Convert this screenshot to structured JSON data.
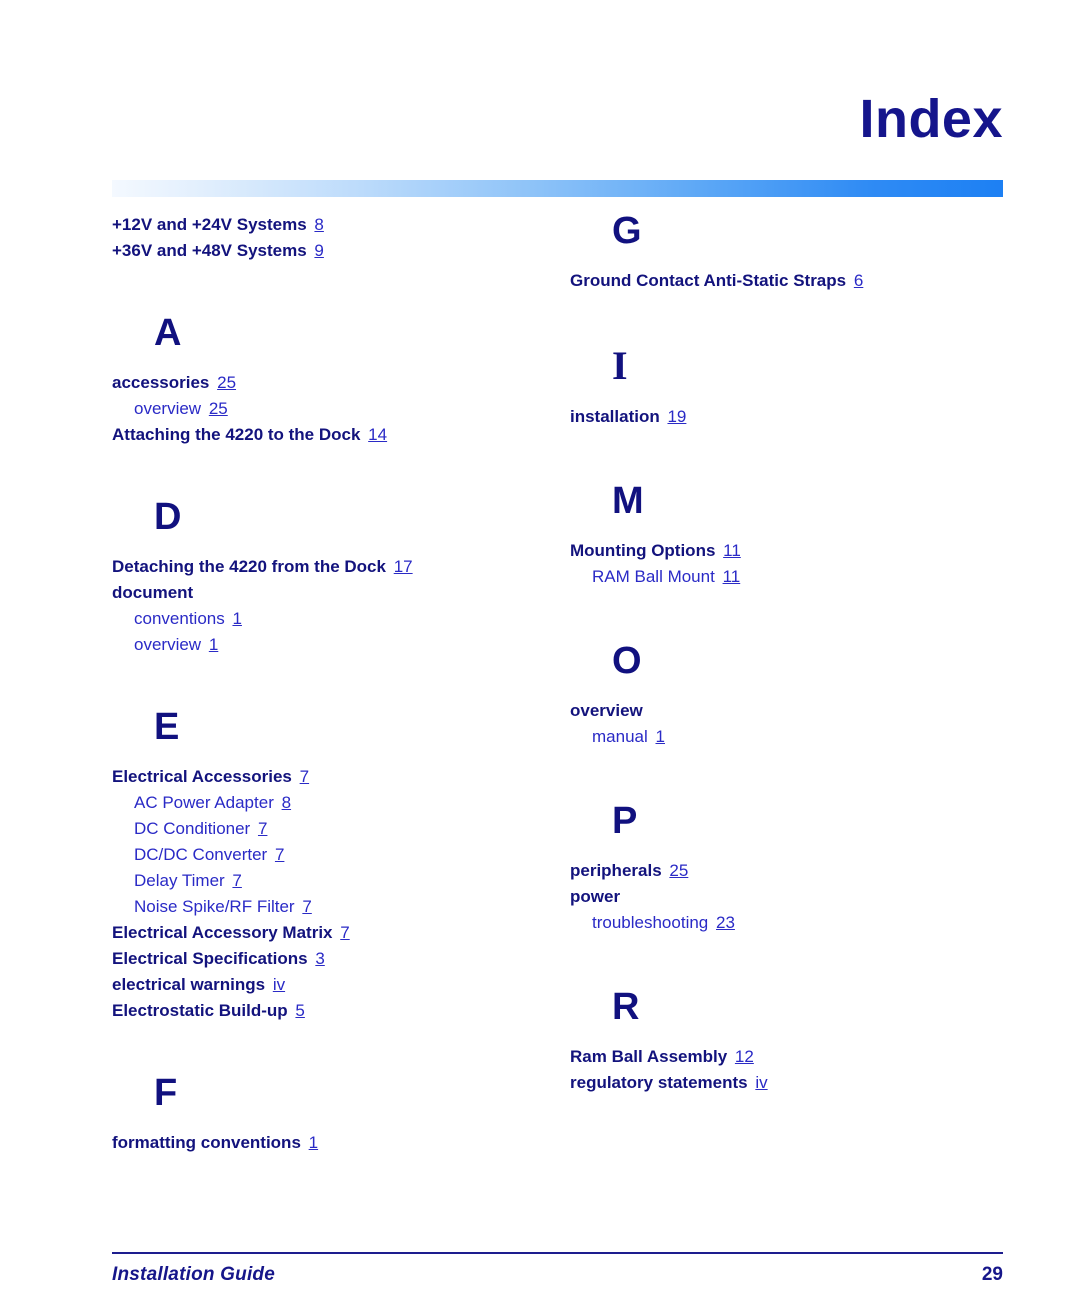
{
  "header": {
    "title": "Index"
  },
  "footer": {
    "guide_label": "Installation Guide",
    "page_number": "29"
  },
  "colors": {
    "heading_navy": "#15158c",
    "main_entry": "#13137d",
    "sub_entry": "#2a2ac6",
    "gradient_start": "#f4f9ff",
    "gradient_end": "#1d80f3",
    "footer_rule": "#1d1d8e"
  },
  "columns": {
    "left": [
      {
        "letter": "",
        "entries": [
          {
            "level": "main",
            "text": "+12V and +24V Systems",
            "page": "8"
          },
          {
            "level": "main",
            "text": "+36V and +48V Systems",
            "page": "9"
          }
        ]
      },
      {
        "letter": "A",
        "entries": [
          {
            "level": "main",
            "text": "accessories",
            "page": "25"
          },
          {
            "level": "sub",
            "text": "overview",
            "page": "25"
          },
          {
            "level": "main",
            "text": "Attaching the 4220 to the Dock",
            "page": "14"
          }
        ]
      },
      {
        "letter": "D",
        "entries": [
          {
            "level": "main",
            "text": "Detaching the 4220 from the Dock",
            "page": "17"
          },
          {
            "level": "main",
            "text": "document",
            "page": ""
          },
          {
            "level": "sub",
            "text": "conventions",
            "page": "1"
          },
          {
            "level": "sub",
            "text": "overview",
            "page": "1"
          }
        ]
      },
      {
        "letter": "E",
        "entries": [
          {
            "level": "main",
            "text": "Electrical Accessories",
            "page": "7"
          },
          {
            "level": "sub",
            "text": "AC Power Adapter",
            "page": "8"
          },
          {
            "level": "sub",
            "text": "DC Conditioner",
            "page": "7"
          },
          {
            "level": "sub",
            "text": "DC/DC Converter",
            "page": "7"
          },
          {
            "level": "sub",
            "text": "Delay Timer",
            "page": "7"
          },
          {
            "level": "sub",
            "text": "Noise Spike/RF Filter",
            "page": "7"
          },
          {
            "level": "main",
            "text": "Electrical Accessory Matrix",
            "page": "7"
          },
          {
            "level": "main",
            "text": "Electrical Specifications",
            "page": "3"
          },
          {
            "level": "main",
            "text": "electrical warnings",
            "page": "iv"
          },
          {
            "level": "main",
            "text": "Electrostatic Build-up",
            "page": "5"
          }
        ]
      },
      {
        "letter": "F",
        "entries": [
          {
            "level": "main",
            "text": "formatting conventions",
            "page": "1"
          }
        ]
      }
    ],
    "right": [
      {
        "letter": "G",
        "entries": [
          {
            "level": "main",
            "text": "Ground Contact Anti-Static Straps",
            "page": "6"
          }
        ]
      },
      {
        "letter": "I",
        "entries": [
          {
            "level": "main",
            "text": "installation",
            "page": "19"
          }
        ]
      },
      {
        "letter": "M",
        "entries": [
          {
            "level": "main",
            "text": "Mounting Options",
            "page": "11"
          },
          {
            "level": "sub",
            "text": "RAM Ball Mount",
            "page": "11"
          }
        ]
      },
      {
        "letter": "O",
        "entries": [
          {
            "level": "main",
            "text": "overview",
            "page": ""
          },
          {
            "level": "sub",
            "text": "manual",
            "page": "1"
          }
        ]
      },
      {
        "letter": "P",
        "entries": [
          {
            "level": "main",
            "text": "peripherals",
            "page": "25"
          },
          {
            "level": "main",
            "text": "power",
            "page": ""
          },
          {
            "level": "sub",
            "text": "troubleshooting",
            "page": "23"
          }
        ]
      },
      {
        "letter": "R",
        "entries": [
          {
            "level": "main",
            "text": "Ram Ball Assembly",
            "page": "12"
          },
          {
            "level": "main",
            "text": "regulatory statements",
            "page": "iv"
          }
        ]
      }
    ]
  }
}
